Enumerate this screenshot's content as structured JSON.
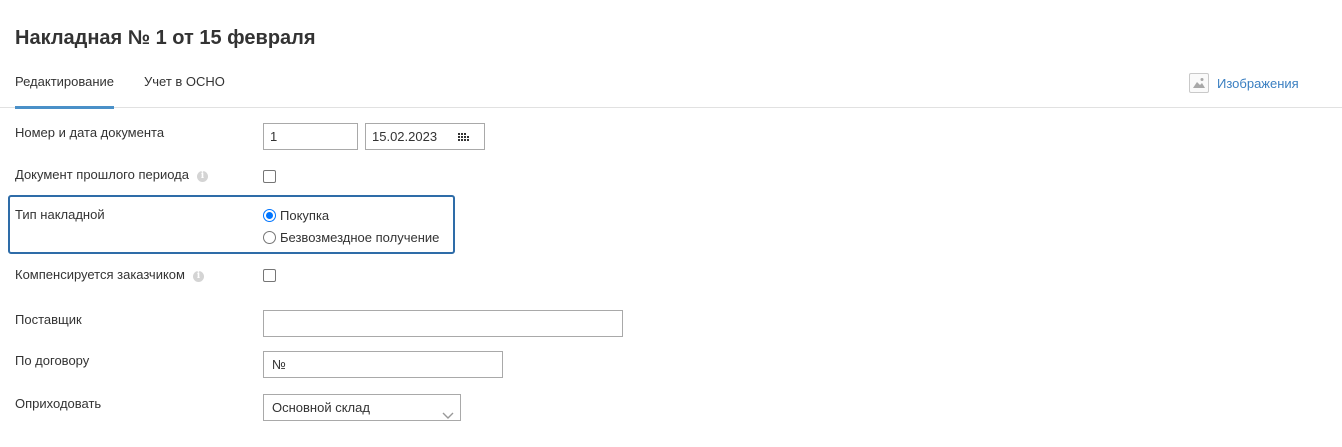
{
  "page": {
    "title": "Накладная № 1 от 15 февраля"
  },
  "tabs": [
    {
      "label": "Редактирование",
      "active": true
    },
    {
      "label": "Учет в ОСНО",
      "active": false
    }
  ],
  "images_link": {
    "label": "Изображения",
    "icon": "image-icon"
  },
  "form": {
    "doc_number": {
      "label": "Номер и дата документа",
      "number_value": "1",
      "date_value": "15.02.2023"
    },
    "prior_period": {
      "label": "Документ прошлого периода",
      "checked": false
    },
    "invoice_type": {
      "label": "Тип накладной",
      "options": [
        {
          "label": "Покупка",
          "checked": true
        },
        {
          "label": "Безвозмездное получение",
          "checked": false
        }
      ]
    },
    "customer_compensated": {
      "label": "Компенсируется заказчиком",
      "checked": false
    },
    "supplier": {
      "label": "Поставщик",
      "value": ""
    },
    "contract": {
      "label": "По договору",
      "value": "№"
    },
    "stock_in": {
      "label": "Оприходовать",
      "selected": "Основной склад"
    }
  },
  "colors": {
    "accent": "#4a90c8",
    "link": "#3a7fc1",
    "focus": "#2e6ca8"
  }
}
